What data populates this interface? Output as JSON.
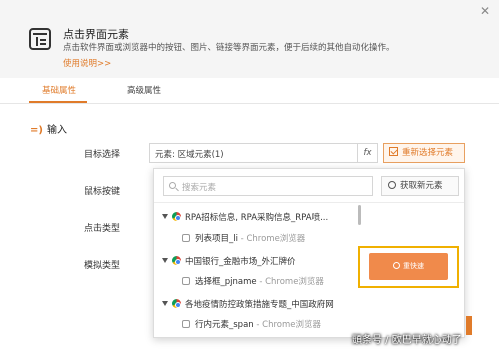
{
  "header": {
    "title": "点击界面元素",
    "description": "点击软件界面或浏览器中的按钮、图片、链接等界面元素，便于后续的其他自动化操作。",
    "help_link": "使用说明>>",
    "icon": "element-window-icon",
    "close_icon": "close-icon"
  },
  "tabs": [
    {
      "label": "基础属性",
      "active": true
    },
    {
      "label": "高级属性",
      "active": false
    }
  ],
  "section": {
    "mark": "=)",
    "title": "输入"
  },
  "form": {
    "labels": [
      "目标选择",
      "鼠标按键",
      "点击类型",
      "模拟类型"
    ],
    "target_value": "元素: 区域元素(1)",
    "fx_label": "fx",
    "reselect_label": "重新选择元素"
  },
  "popup": {
    "search_placeholder": "搜索元素",
    "get_new_label": "获取新元素",
    "groups": [
      {
        "title": "RPA招标信息, RPA采购信息_RPA喷...",
        "items": [
          {
            "name": "列表项目_li",
            "suffix": " - Chrome浏览器"
          }
        ]
      },
      {
        "title": "中国银行_金融市场_外汇牌价",
        "items": [
          {
            "name": "选择框_pjname",
            "suffix": " - Chrome浏览器"
          }
        ]
      },
      {
        "title": "各地疫情防控政策措施专题_中国政府网",
        "items": [
          {
            "name": "行内元素_span",
            "suffix": " - Chrome浏览器"
          }
        ]
      }
    ],
    "pick_button_label": "重快速"
  },
  "watermark": "頭条号 / 欧巴早就心动了",
  "colors": {
    "accent": "#e07b2a",
    "highlight": "#f0b000",
    "pick_button": "#f08a4b"
  }
}
